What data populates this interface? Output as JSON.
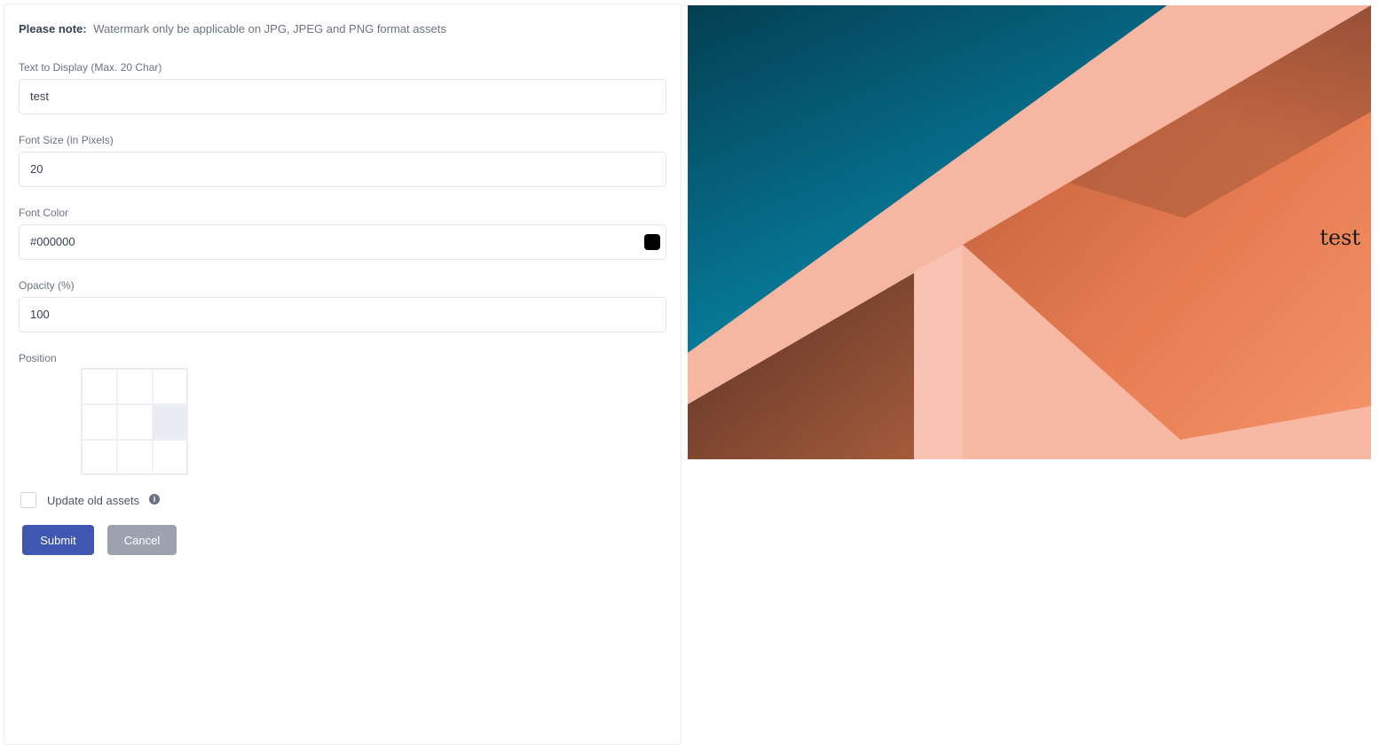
{
  "note": {
    "bold": "Please note:",
    "text": "Watermark only be applicable on JPG, JPEG and PNG format assets"
  },
  "fields": {
    "text": {
      "label": "Text to Display (Max. 20 Char)",
      "value": "test"
    },
    "font_size": {
      "label": "Font Size (in Pixels)",
      "value": "20"
    },
    "font_color": {
      "label": "Font Color",
      "value": "#000000",
      "swatch": "#000000"
    },
    "opacity": {
      "label": "Opacity (%)",
      "value": "100"
    }
  },
  "position": {
    "label": "Position",
    "selected": "middle-right"
  },
  "update_all": {
    "label": "Update old assets",
    "checked": false,
    "info_icon": "info-icon"
  },
  "buttons": {
    "submit": "Submit",
    "cancel": "Cancel"
  },
  "preview": {
    "watermark_text": "test"
  },
  "colors": {
    "submit": "#3f57b0",
    "cancel": "#9ca3ae"
  }
}
